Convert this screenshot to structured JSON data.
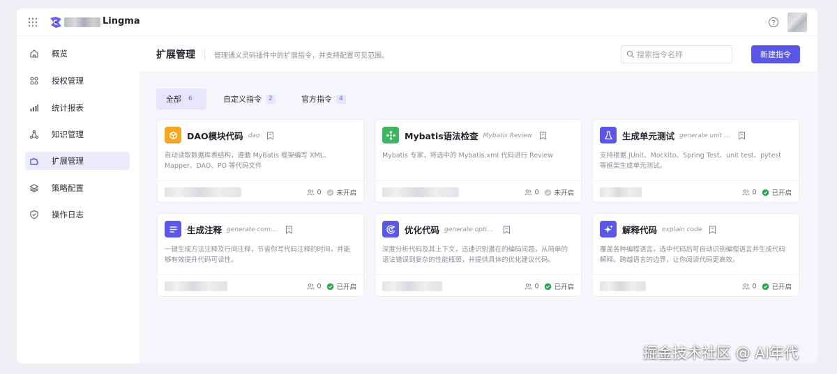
{
  "app": {
    "brand_name": "Lingma"
  },
  "sidebar": {
    "items": [
      {
        "label": "概览",
        "icon": "home-icon"
      },
      {
        "label": "授权管理",
        "icon": "grid-dots-icon"
      },
      {
        "label": "统计报表",
        "icon": "bar-chart-icon"
      },
      {
        "label": "知识管理",
        "icon": "triangle-nodes-icon"
      },
      {
        "label": "扩展管理",
        "icon": "puzzle-icon",
        "active": true
      },
      {
        "label": "策略配置",
        "icon": "layers-icon"
      },
      {
        "label": "操作日志",
        "icon": "shield-icon"
      }
    ]
  },
  "header": {
    "title": "扩展管理",
    "description": "管理通义灵码插件中的扩展指令，并支持配置可见范围。",
    "search_placeholder": "搜索指令名称",
    "new_button": "新建指令"
  },
  "tabs": [
    {
      "label": "全部",
      "count": "6",
      "active": true
    },
    {
      "label": "自定义指令",
      "count": "2"
    },
    {
      "label": "官方指令",
      "count": "4"
    }
  ],
  "cards": [
    {
      "title": "DAO模块代码",
      "subtitle": "dao",
      "description": "自动读取数据库表结构，遵循 MyBatis 框架编写 XML、Mapper、DAO、PO 等代码文件",
      "users": "0",
      "status": "未开启",
      "enabled": false,
      "icon": "box-icon",
      "icon_color": "#f5a623"
    },
    {
      "title": "Mybatis语法检查",
      "subtitle": "Mybatis Review",
      "description": "Mybatis 专家，将选中的 Mybatis.xml 代码进行 Review",
      "users": "0",
      "status": "未开启",
      "enabled": false,
      "icon": "nodes-icon",
      "icon_color": "#3fb561"
    },
    {
      "title": "生成单元测试",
      "subtitle": "generate unit test",
      "description": "支持根据 JUnit、Mockito、Spring Test、unit test、pytest 等框架生成单元测试。",
      "users": "0",
      "status": "已开启",
      "enabled": true,
      "icon": "flask-icon",
      "icon_color": "#5b57e6"
    },
    {
      "title": "生成注释",
      "subtitle": "generate comment",
      "description": "一键生成方法注释及行间注释，节省你写代码注释的时间，并能够有效提升代码可读性。",
      "users": "0",
      "status": "已开启",
      "enabled": true,
      "icon": "lines-icon",
      "icon_color": "#5b57e6"
    },
    {
      "title": "优化代码",
      "subtitle": "generate optimization",
      "description": "深度分析代码及其上下文，迅速识别潜在的编码问题，从简单的语法错误到复杂的性能瓶颈，并提供具体的优化建议代码。",
      "users": "0",
      "status": "已开启",
      "enabled": true,
      "icon": "optimize-icon",
      "icon_color": "#5b57e6"
    },
    {
      "title": "解释代码",
      "subtitle": "explain code",
      "description": "覆盖各种编程语言，选中代码后可自动识别编程语言并生成代码解释。跨越语言的边界，让你阅读代码更高效。",
      "users": "0",
      "status": "已开启",
      "enabled": true,
      "icon": "sparkle-icon",
      "icon_color": "#5b57e6"
    }
  ],
  "colors": {
    "accent": "#5b57e6",
    "enabled": "#2ea44f",
    "disabled": "#b5b8bf"
  },
  "watermark": "掘金技术社区 @ AI年代"
}
